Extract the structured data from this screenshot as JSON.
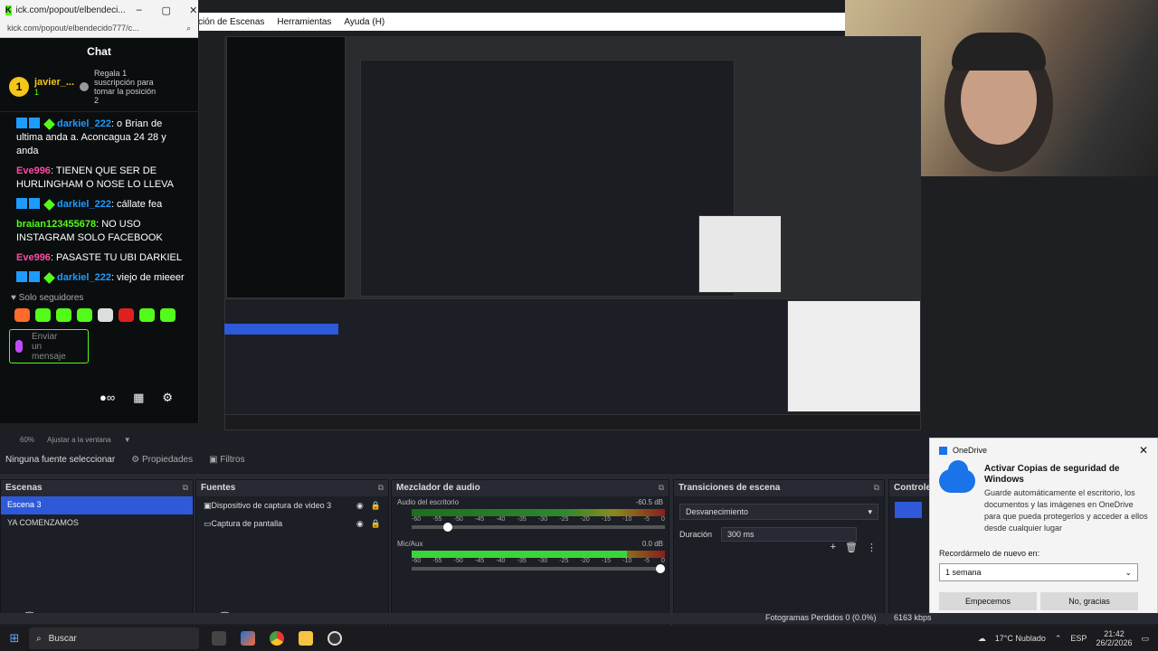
{
  "menubar": {
    "items": [
      "ción de Escenas",
      "Herramientas",
      "Ayuda (H)"
    ]
  },
  "kick": {
    "window_title": "ick.com/popout/elbendeci...",
    "url": "kick.com/popout/elbendecido777/c...",
    "chat_title": "Chat",
    "pinned": {
      "rank": "1",
      "user": "javier_...",
      "gift_count": "1",
      "text": "Regala 1 suscripción para tomar la posición 2"
    },
    "messages": [
      {
        "user": "darkiel_222",
        "color": "blue",
        "text": ": o Brian de ultima anda a. Aconcagua 24 28 y anda"
      },
      {
        "user": "Eve996",
        "color": "pink",
        "text": ": TIENEN QUE SER DE HURLINGHAM O NOSE LO LLEVA"
      },
      {
        "user": "darkiel_222",
        "color": "blue",
        "text": ": cállate fea"
      },
      {
        "user": "braian123455678",
        "color": "green",
        "text": ": NO USO INSTAGRAM SOLO FACEBOOK"
      },
      {
        "user": "Eve996",
        "color": "pink",
        "text": ": PASASTE TU UBI DARKIEL"
      },
      {
        "user": "darkiel_222",
        "color": "blue",
        "text": ": viejo de mieeer"
      }
    ],
    "followers_only": "Solo seguidores",
    "input_placeholder": "Enviar un mensaje"
  },
  "obs": {
    "zoom": "60%",
    "fit_label": "Ajustar a la ventana",
    "no_source": "Ninguna fuente seleccionar",
    "properties": "Propiedades",
    "filters": "Filtros",
    "scenes_title": "Escenas",
    "scenes": [
      "Escena 3",
      "YA COMENZAMOS"
    ],
    "sources_title": "Fuentes",
    "sources": [
      "Dispositivo de captura de video 3",
      "Captura de pantalla"
    ],
    "mixer_title": "Mezclador de audio",
    "mixer": [
      {
        "name": "Audio del escritorio",
        "db": "-60.5 dB",
        "level": 0.0,
        "volume": 0.16
      },
      {
        "name": "Mic/Aux",
        "db": "0.0 dB",
        "level": 0.85,
        "volume": 1.0
      }
    ],
    "ticks": [
      "-60",
      "-55",
      "-50",
      "-45",
      "-40",
      "-35",
      "-30",
      "-25",
      "-20",
      "-15",
      "-10",
      "-5",
      "0"
    ],
    "transitions_title": "Transiciones de escena",
    "transition": "Desvanecimiento",
    "duration_label": "Duración",
    "duration": "300 ms",
    "controls_title": "Controles",
    "frames_lost": "Fotogramas Perdidos 0 (0.0%)",
    "kbps": "6163 kbps"
  },
  "onedrive": {
    "app": "OneDrive",
    "title": "Activar Copias de seguridad de Windows",
    "body": "Guarde automáticamente el escritorio, los documentos y las imágenes en OneDrive para que pueda protegerlos y acceder a ellos desde cualquier lugar",
    "remind_label": "Recordármelo de nuevo en:",
    "remind_value": "1 semana",
    "start_btn": "Empecemos",
    "no_btn": "No, gracias"
  },
  "taskbar": {
    "search": "Buscar",
    "weather": "17°C  Nublado",
    "lang": "ESP",
    "time": "21:42",
    "date": "26/2/2026"
  }
}
